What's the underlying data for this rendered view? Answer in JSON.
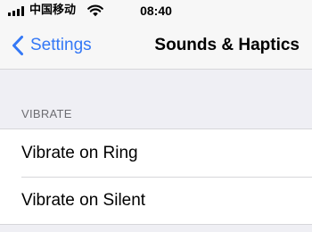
{
  "status_bar": {
    "carrier": "中国移动",
    "time": "08:40",
    "signal_icon": "signal-bars-icon",
    "wifi_icon": "wifi-icon"
  },
  "nav": {
    "back_label": "Settings",
    "back_icon": "chevron-left-icon",
    "title": "Sounds & Haptics",
    "accent_color": "#3478f6"
  },
  "vibrate_section": {
    "header": "VIBRATE",
    "items": [
      {
        "label": "Vibrate on Ring"
      },
      {
        "label": "Vibrate on Silent"
      }
    ]
  }
}
